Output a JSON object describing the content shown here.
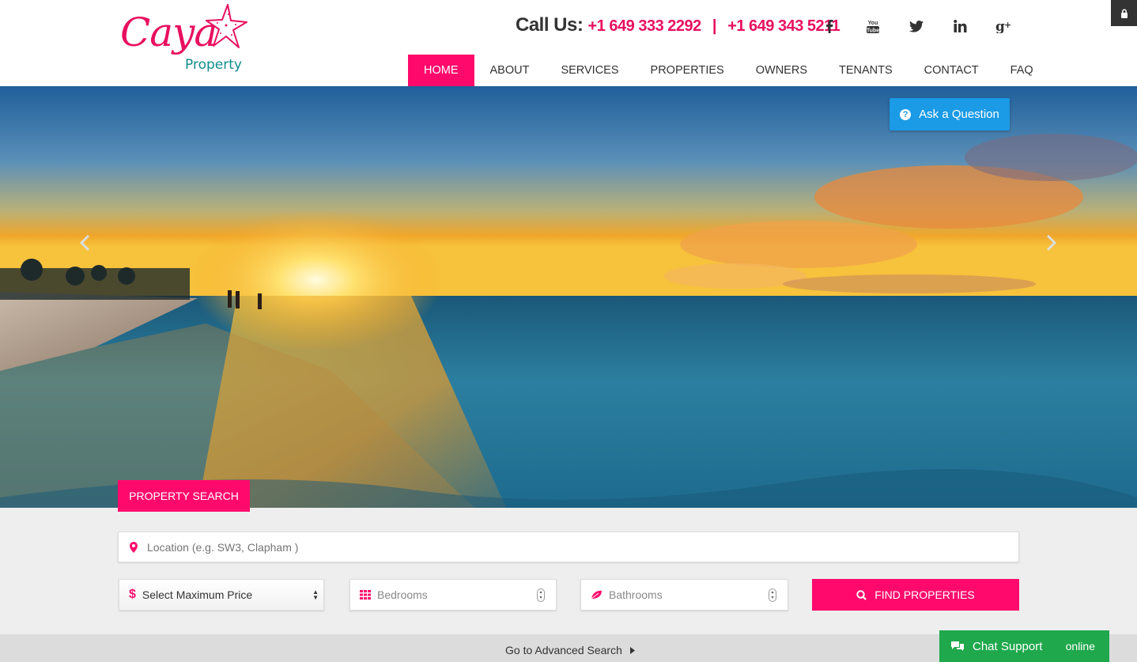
{
  "brand": {
    "logo_script": "Caya",
    "logo_sub": "Property",
    "colors": {
      "accent": "#ff0a6c",
      "teal": "#0f8c8c",
      "blue": "#1b9ae6",
      "green": "#1fa84c"
    }
  },
  "header": {
    "call_label": "Call Us:",
    "phone1": "+1 649 333 2292",
    "separator": "|",
    "phone2": "+1 649 343 5211",
    "social": [
      {
        "name": "facebook-icon",
        "glyph": "f"
      },
      {
        "name": "youtube-icon",
        "glyph": "You Tube"
      },
      {
        "name": "twitter-icon",
        "glyph": "twitter"
      },
      {
        "name": "linkedin-icon",
        "glyph": "in"
      },
      {
        "name": "google-plus-icon",
        "glyph": "g+"
      }
    ]
  },
  "nav": {
    "items": [
      {
        "label": "HOME",
        "active": true
      },
      {
        "label": "ABOUT"
      },
      {
        "label": "SERVICES"
      },
      {
        "label": "PROPERTIES"
      },
      {
        "label": "OWNERS"
      },
      {
        "label": "TENANTS"
      },
      {
        "label": "CONTACT"
      },
      {
        "label": "FAQ"
      }
    ]
  },
  "hero": {
    "ask_button": "Ask a Question"
  },
  "search": {
    "tab_label": "PROPERTY SEARCH",
    "location_placeholder": "Location (e.g. SW3, Clapham )",
    "price_label": "Select Maximum Price",
    "bedrooms_placeholder": "Bedrooms",
    "bathrooms_placeholder": "Bathrooms",
    "find_button": "FIND PROPERTIES",
    "advanced_link": "Go to Advanced Search"
  },
  "chat": {
    "label": "Chat Support",
    "status": "online"
  }
}
